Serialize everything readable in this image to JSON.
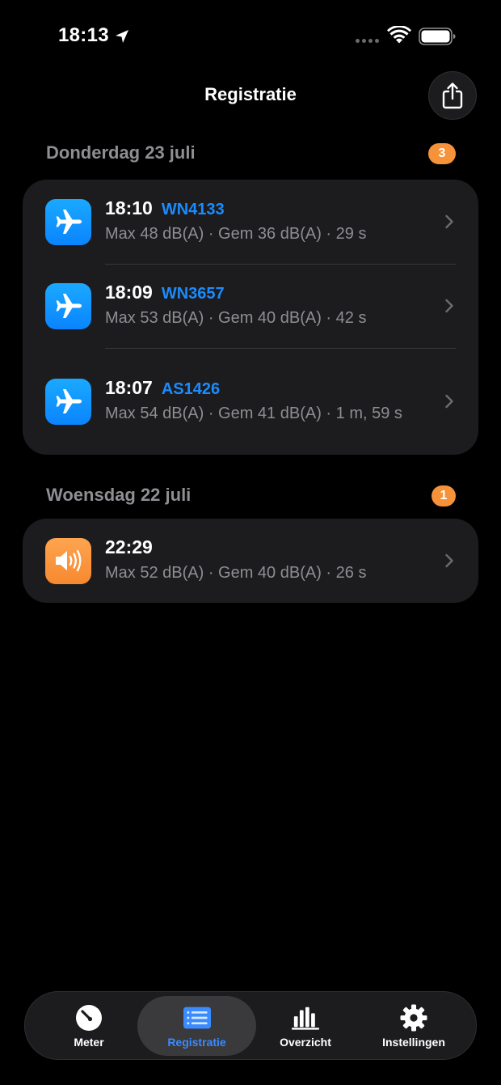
{
  "status_bar": {
    "time": "18:13"
  },
  "nav": {
    "title": "Registratie"
  },
  "sections": [
    {
      "title": "Donderdag 23 juli",
      "count": "3",
      "rows": [
        {
          "time": "18:10",
          "flight": "WN4133",
          "details": "Max 48 dB(A) · Gem 36 dB(A) · 29 s",
          "icon": "airplane-icon"
        },
        {
          "time": "18:09",
          "flight": "WN3657",
          "details": "Max 53 dB(A) · Gem 40 dB(A) · 42 s",
          "icon": "airplane-icon"
        },
        {
          "time": "18:07",
          "flight": "AS1426",
          "details": "Max 54 dB(A) · Gem 41 dB(A) · 1 m, 59 s",
          "icon": "airplane-icon"
        }
      ]
    },
    {
      "title": "Woensdag 22 juli",
      "count": "1",
      "rows": [
        {
          "time": "22:29",
          "flight": "",
          "details": "Max 52 dB(A) · Gem 40 dB(A) · 26 s",
          "icon": "speaker-icon"
        }
      ]
    }
  ],
  "tabs": [
    {
      "label": "Meter",
      "icon": "gauge-icon"
    },
    {
      "label": "Registratie",
      "icon": "list-icon"
    },
    {
      "label": "Overzicht",
      "icon": "bar-chart-icon"
    },
    {
      "label": "Instellingen",
      "icon": "gear-icon"
    }
  ],
  "colors": {
    "accent": "#1a8cff",
    "badge": "#f6923a",
    "card": "#1c1c1e",
    "airplane_icon_bg": "#0a84ff",
    "speaker_icon_bg": "#f6892f"
  }
}
